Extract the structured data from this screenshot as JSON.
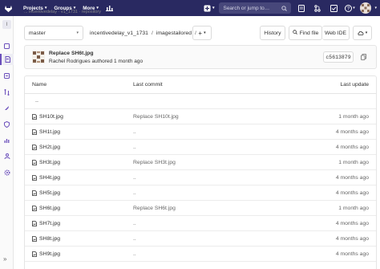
{
  "topbar": {
    "menus": [
      {
        "label": "Projects"
      },
      {
        "label": "Groups"
      },
      {
        "label": "More"
      }
    ],
    "search_placeholder": "Search or jump to…",
    "nav_bg": "#292961"
  },
  "sidebar": {
    "project_initial": "I"
  },
  "breadcrumb": {
    "text": "...  incentivedelay  ·  v1_1731  ·  repository"
  },
  "toolbar": {
    "branch": "master",
    "path_root": "incentivedelay_v1_1731",
    "path_dir": "imagestailored",
    "path_sep": "/",
    "add_label": "+",
    "history_label": "History",
    "find_file_label": "Find file",
    "web_ide_label": "Web IDE"
  },
  "last_commit": {
    "title": "Replace SH6t.jpg",
    "author": "Rachel Rodrigues",
    "meta_suffix": "authored 1 month ago",
    "sha": "c5613879"
  },
  "tree": {
    "col_name": "Name",
    "col_commit": "Last commit",
    "col_update": "Last update",
    "parent_link": "..",
    "rows": [
      {
        "name": "SH10t.jpg",
        "commit": "Replace SH10t.jpg",
        "updated": "1 month ago"
      },
      {
        "name": "SH1t.jpg",
        "commit": "..",
        "updated": "4 months ago"
      },
      {
        "name": "SH2t.jpg",
        "commit": "..",
        "updated": "4 months ago"
      },
      {
        "name": "SH3t.jpg",
        "commit": "Replace SH3t.jpg",
        "updated": "1 month ago"
      },
      {
        "name": "SH4t.jpg",
        "commit": "..",
        "updated": "4 months ago"
      },
      {
        "name": "SH5t.jpg",
        "commit": "..",
        "updated": "4 months ago"
      },
      {
        "name": "SH6t.jpg",
        "commit": "Replace SH6t.jpg",
        "updated": "1 month ago"
      },
      {
        "name": "SH7t.jpg",
        "commit": "..",
        "updated": "4 months ago"
      },
      {
        "name": "SH8t.jpg",
        "commit": "..",
        "updated": "4 months ago"
      },
      {
        "name": "SH9t.jpg",
        "commit": "..",
        "updated": "4 months ago"
      }
    ]
  }
}
